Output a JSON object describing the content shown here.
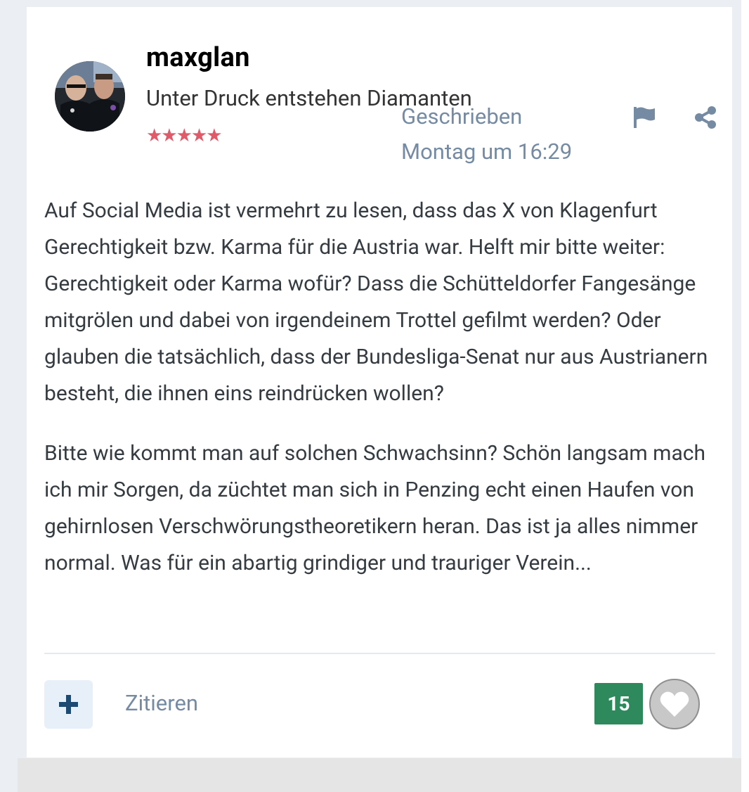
{
  "post": {
    "author_name": "maxglan",
    "author_tagline": "Unter Druck entstehen Diamanten",
    "rank_stars": "★★★★★",
    "posted_label": "Geschrieben",
    "posted_time": "Montag um 16:29",
    "paragraphs": [
      "Auf Social Media ist vermehrt zu lesen, dass das X von Klagenfurt Gerechtigkeit bzw. Karma für die Austria war. Helft mir bitte weiter: Gerechtigkeit oder Karma wofür? Dass die Schütteldorfer Fangesänge mitgrölen und dabei von irgendeinem Trottel gefilmt werden? Oder glauben die tatsächlich, dass der Bundesliga-Senat nur aus Austrianern besteht, die ihnen eins reindrücken wollen?",
      "Bitte wie kommt man auf solchen Schwachsinn? Schön langsam mach ich mir Sorgen, da züchtet man sich in Penzing echt einen Haufen von gehirnlosen Verschwörungstheoretikern heran. Das ist ja alles nimmer normal. Was für ein abartig grindiger und trauriger Verein..."
    ]
  },
  "actions": {
    "plus_icon": "plus-icon",
    "quote_label": "Zitieren",
    "reaction_count": "15",
    "like_icon": "heart-icon",
    "report_icon": "flag-icon",
    "share_icon": "share-icon"
  },
  "colors": {
    "meta_text": "#758aa3",
    "body_text": "#353c41",
    "reaction_badge": "#2e8a5d",
    "plus_button_bg": "#e7f0f9",
    "stars": "#e05a6a"
  }
}
